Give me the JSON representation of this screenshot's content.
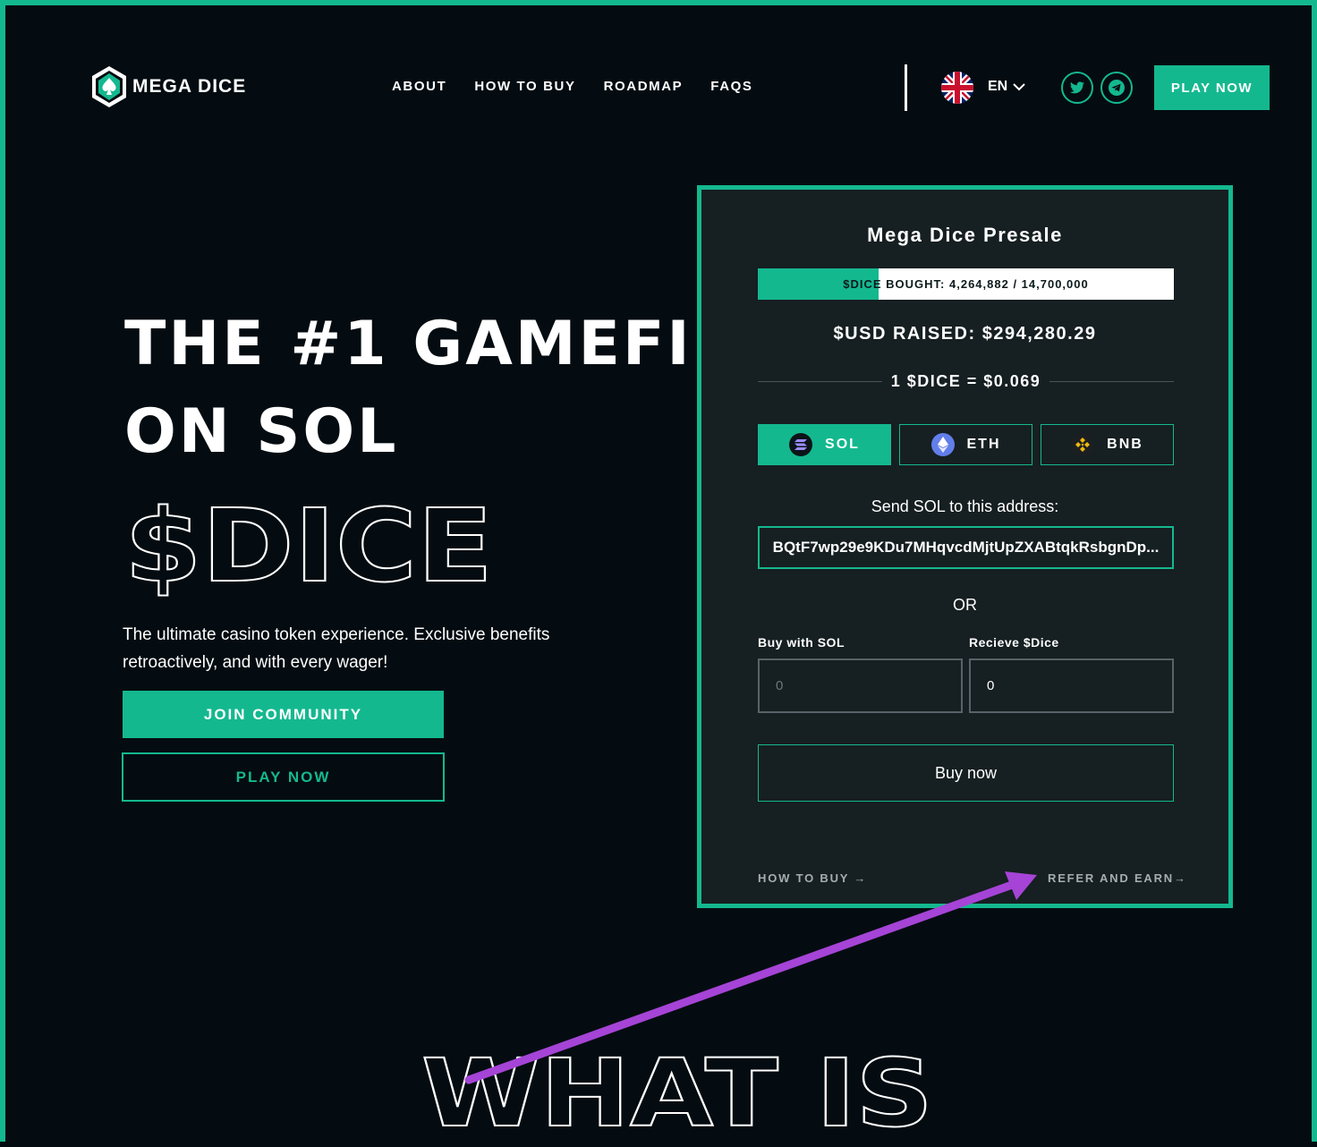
{
  "brand": {
    "name": "MEGA DICE"
  },
  "nav": {
    "items": [
      "ABOUT",
      "HOW TO BUY",
      "ROADMAP",
      "FAQS"
    ],
    "language": "EN",
    "play_now": "PLAY NOW"
  },
  "hero": {
    "title_line1": "THE #1 GAMEFI",
    "title_line2": "ON SOL",
    "token": "$DICE",
    "description": "The ultimate casino token experience. Exclusive benefits retroactively, and with every wager!",
    "join_button": "JOIN COMMUNITY",
    "play_button": "PLAY NOW"
  },
  "presale": {
    "title": "Mega Dice Presale",
    "progress_text": "$DICE BOUGHT: 4,264,882 / 14,700,000",
    "progress_fraction": 0.29,
    "raised": "$USD RAISED: $294,280.29",
    "rate": "1 $DICE = $0.069",
    "tabs": [
      {
        "label": "SOL",
        "active": true
      },
      {
        "label": "ETH",
        "active": false
      },
      {
        "label": "BNB",
        "active": false
      }
    ],
    "send_label": "Send SOL to this address:",
    "address": "BQtF7wp29e9KDu7MHqvcdMjtUpZXABtqkRsbgnDp...",
    "or": "OR",
    "buy_label": "Buy with SOL",
    "receive_label": "Recieve $Dice",
    "buy_placeholder": "0",
    "receive_value": "0",
    "buy_button": "Buy now",
    "how_to_buy": "HOW TO BUY →",
    "refer": "REFER AND EARN→"
  },
  "section": {
    "heading": "WHAT IS"
  },
  "colors": {
    "accent": "#14b88f",
    "background": "#040c11",
    "card": "#161f21",
    "annotation": "#a544d6"
  },
  "icons": [
    "logo-icon",
    "uk-flag-icon",
    "chevron-down-icon",
    "twitter-icon",
    "telegram-icon",
    "solana-icon",
    "ethereum-icon",
    "bnb-icon"
  ]
}
